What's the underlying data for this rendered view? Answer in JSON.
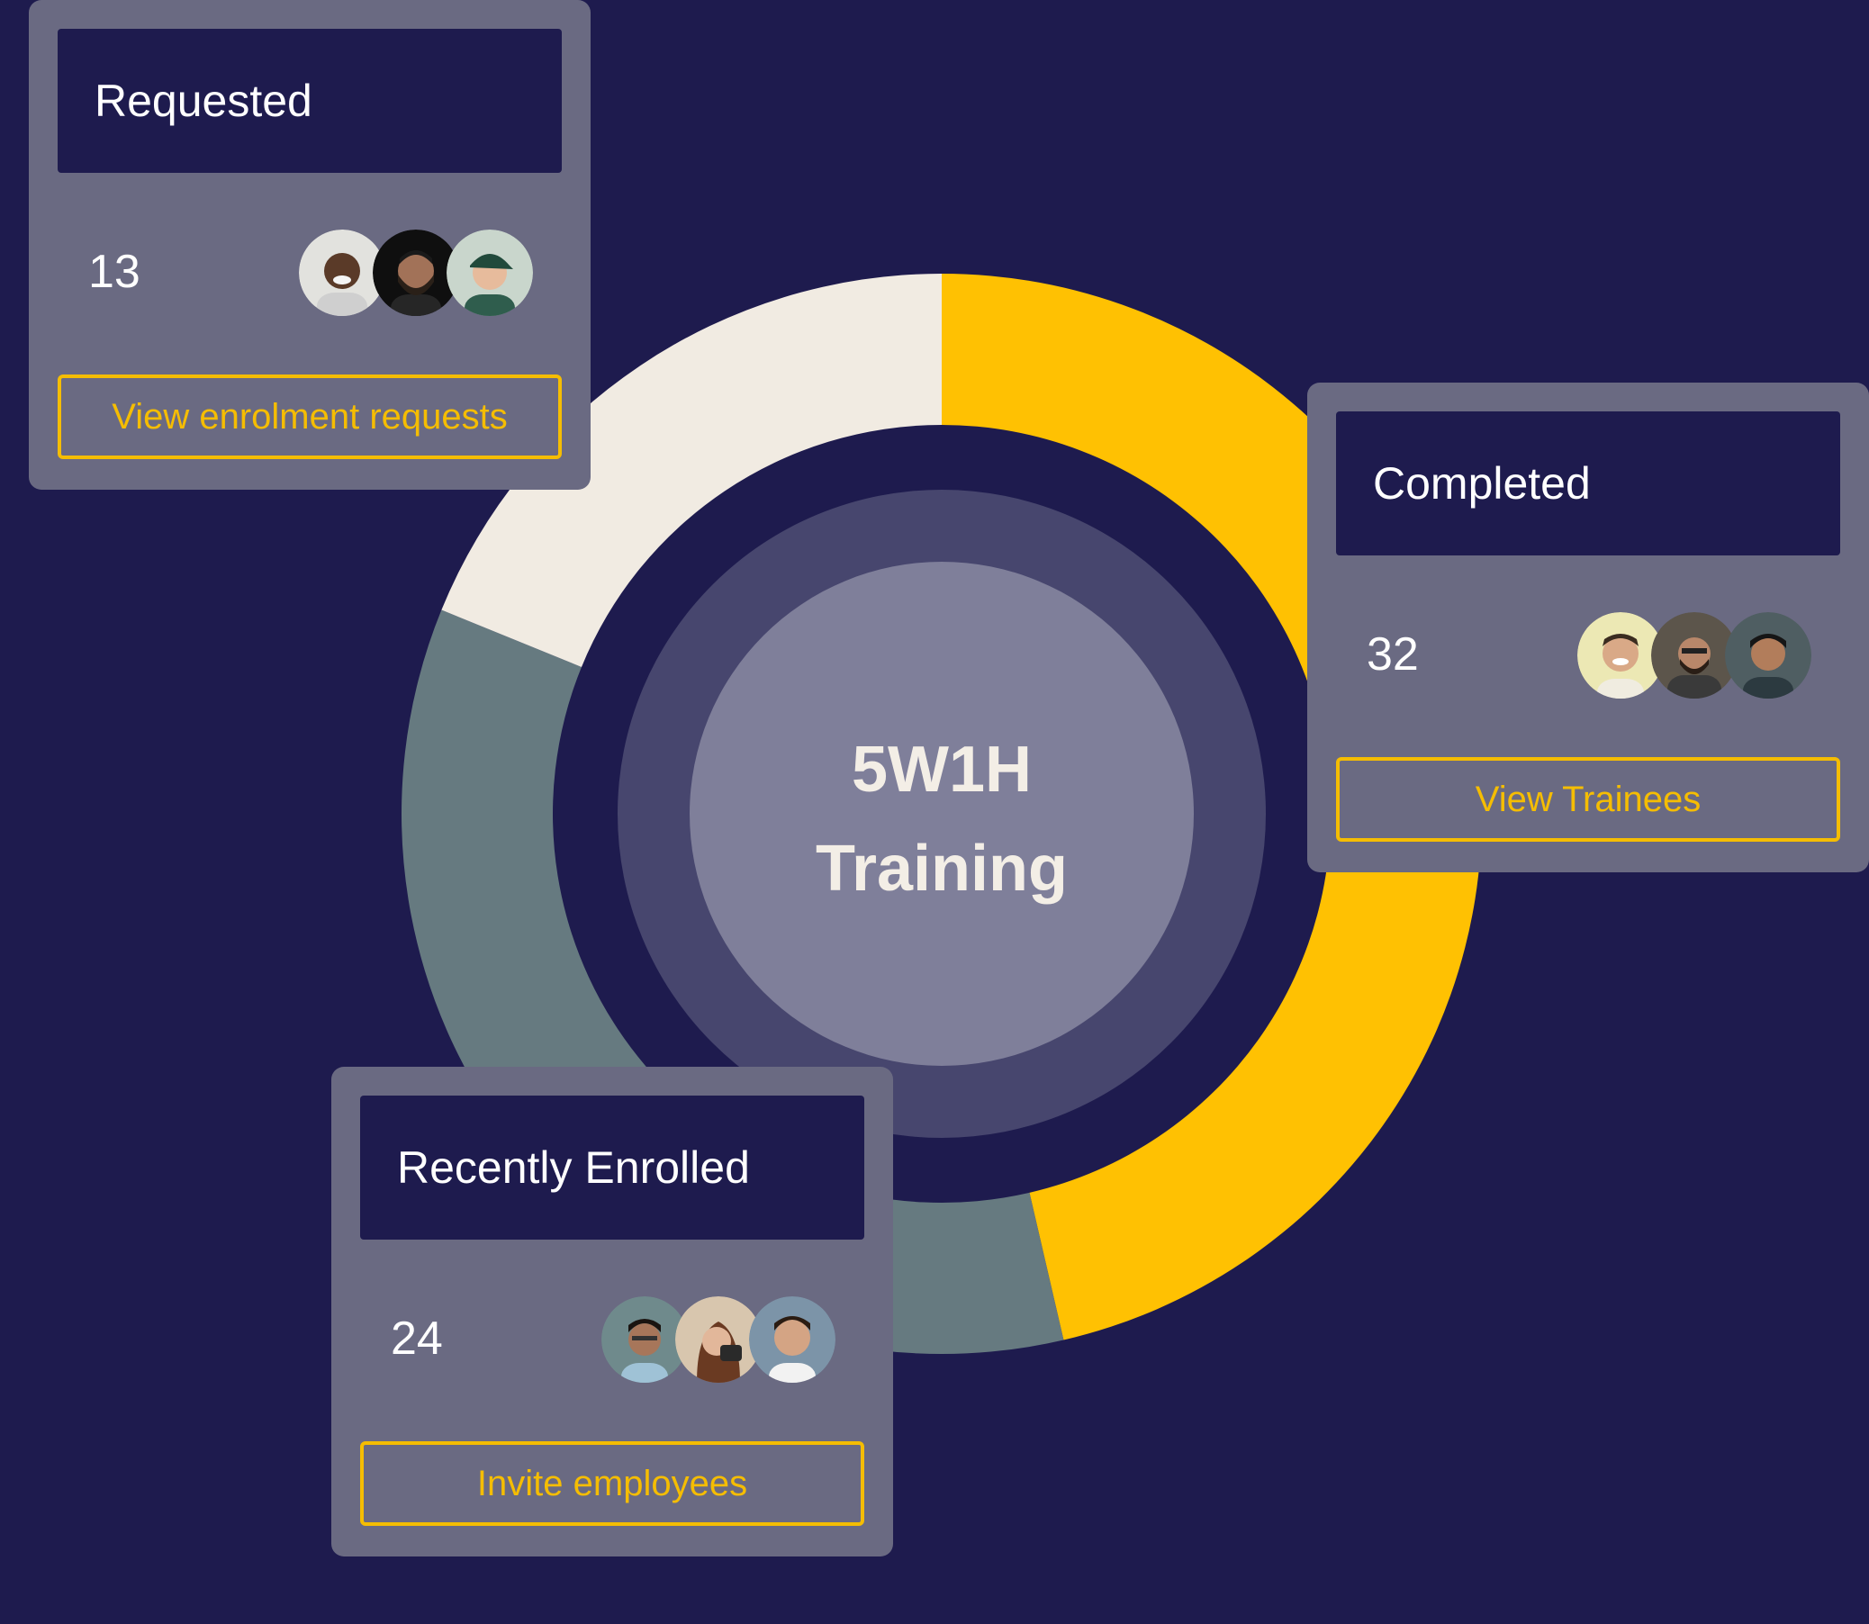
{
  "chart_data": {
    "type": "pie",
    "title": "5W1H Training",
    "segments": [
      {
        "label": "Completed",
        "value": 32,
        "color": "#ffc102"
      },
      {
        "label": "Recently Enrolled",
        "value": 24,
        "color": "#667a80"
      },
      {
        "label": "Requested",
        "value": 13,
        "color": "#f1ebe2"
      }
    ]
  },
  "center": {
    "line1": "5W1H",
    "line2": "Training"
  },
  "cards": {
    "requested": {
      "title": "Requested",
      "count": "13",
      "button": "View enrolment requests",
      "avatars": [
        "person-photo-1",
        "person-photo-2",
        "person-photo-3"
      ]
    },
    "completed": {
      "title": "Completed",
      "count": "32",
      "button": "View Trainees",
      "avatars": [
        "person-photo-4",
        "person-photo-5",
        "person-photo-6"
      ]
    },
    "enrolled": {
      "title": "Recently Enrolled",
      "count": "24",
      "button": "Invite employees",
      "avatars": [
        "person-photo-7",
        "person-photo-8",
        "person-photo-9"
      ]
    }
  },
  "colors": {
    "background": "#1e1b4e",
    "card": "#6a6a82",
    "accent": "#f5bd02"
  }
}
